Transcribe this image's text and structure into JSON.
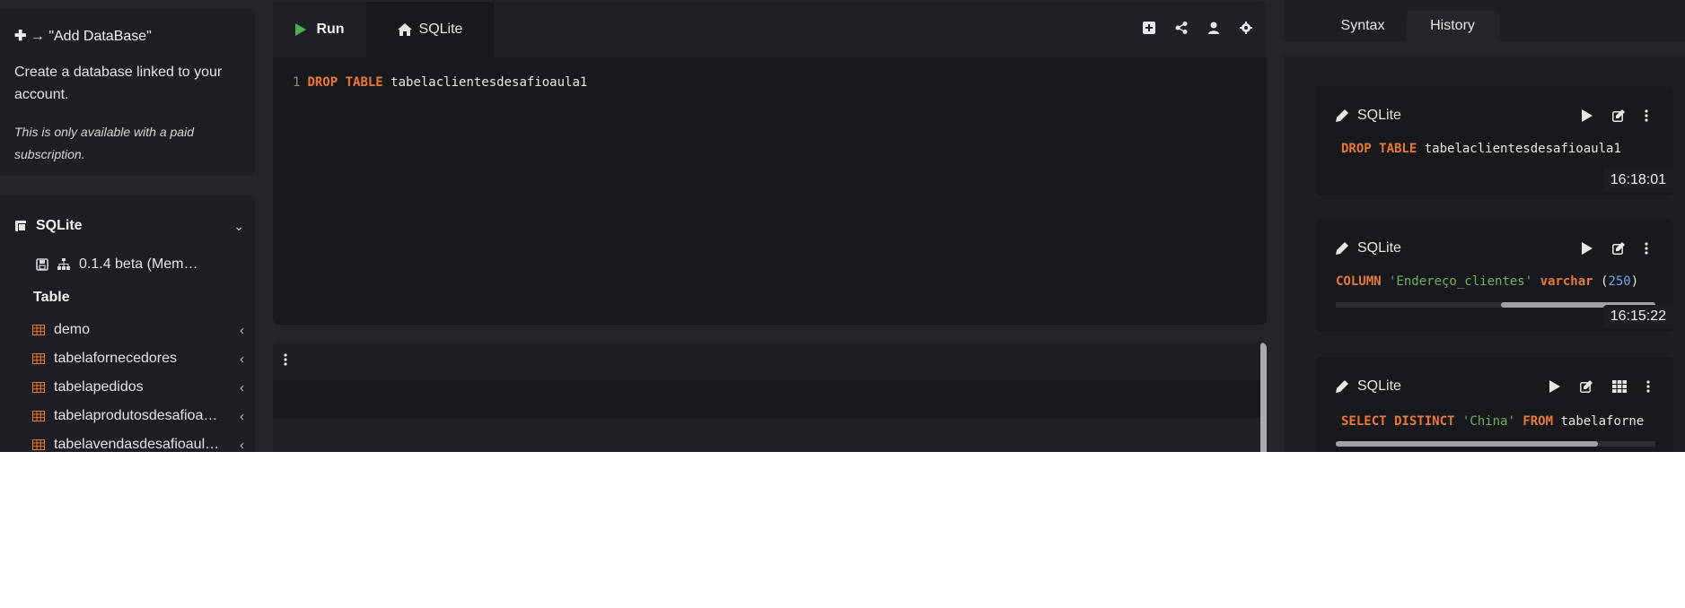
{
  "sidebar": {
    "add_db": {
      "title": "\"Add DataBase\"",
      "description": "Create a database linked to your account.",
      "note": "This is only available with a paid subscription."
    },
    "db": {
      "name": "SQLite",
      "version": "0.1.4 beta (Mem…",
      "table_label": "Table",
      "tables": [
        "demo",
        "tabelafornecedores",
        "tabelapedidos",
        "tabelaprodutosdesafioa…",
        "tabelavendasdesafioaul…"
      ]
    }
  },
  "editor": {
    "run_label": "Run",
    "tab_label": "SQLite",
    "line_number": "1",
    "code": {
      "kw1": "DROP TABLE",
      "rest": " tabelaclientesdesafioaula1"
    }
  },
  "right": {
    "tabs": {
      "syntax": "Syntax",
      "history": "History"
    },
    "history": [
      {
        "engine": "SQLite",
        "kw": "DROP TABLE",
        "rest": " tabelaclientesdesafioaula1",
        "time": "16:18:01"
      },
      {
        "engine": "SQLite",
        "kw": "COLUMN",
        "str": " 'Endereço_clientes'",
        "kw2": " varchar",
        "paren_open": " (",
        "num": "250",
        "paren_close": ")",
        "time": "16:15:22"
      },
      {
        "engine": "SQLite",
        "kw": "SELECT DISTINCT",
        "str": " 'China'",
        "kw2": " FROM",
        "rest": " tabelaforne"
      }
    ]
  },
  "colors": {
    "accent_orange": "#e8793a",
    "run_green": "#4caf50",
    "table_icon": "#e8793a",
    "string_green": "#6fae5e",
    "number_blue": "#6aa6e0"
  }
}
